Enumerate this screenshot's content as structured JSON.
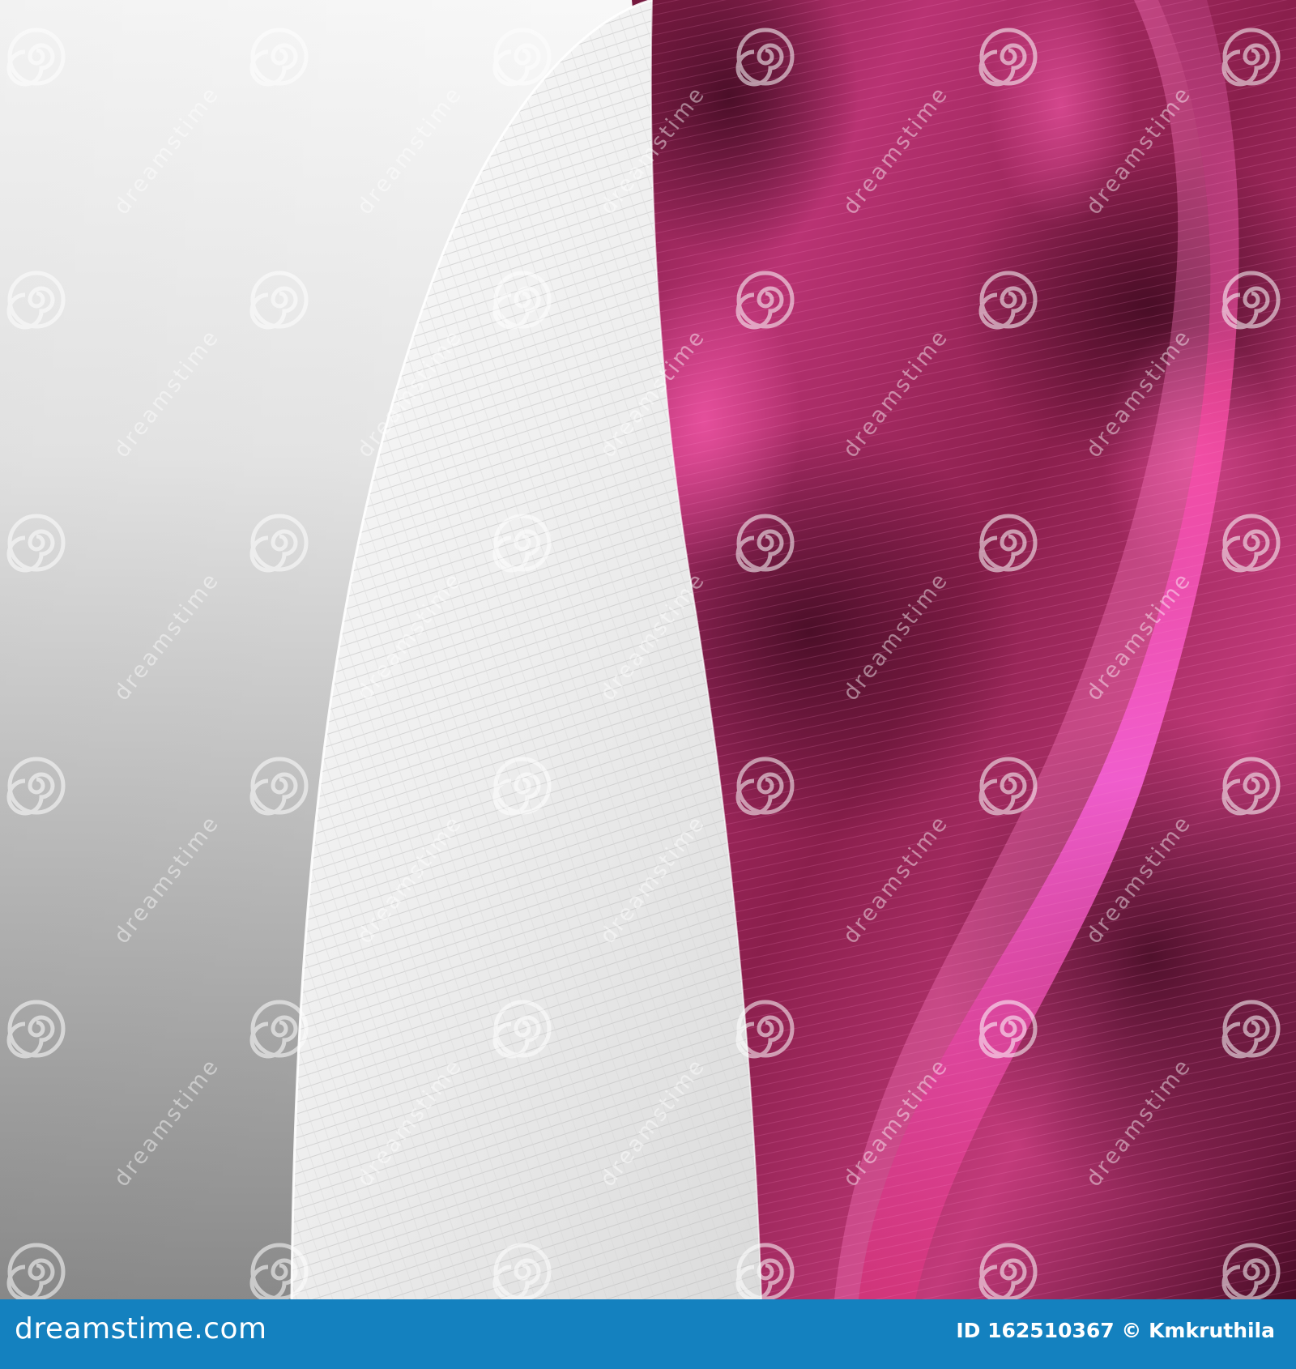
{
  "image": {
    "subject": "abstract-wave-background",
    "colors": {
      "magenta": "#c23a7a",
      "dark_magenta": "#5a0f2e",
      "hot_pink": "#ff4da6",
      "grey_light": "#f2f2f2",
      "grey_dark": "#9e9e9e",
      "footer_blue": "#1481bf"
    }
  },
  "watermark": {
    "word": "dreamstime",
    "icon": "spiral-icon"
  },
  "footer": {
    "logo_text": "dreamstime.com",
    "image_id": "ID 162510367",
    "copyright_icon": "©",
    "author": "Kmkruthila"
  }
}
